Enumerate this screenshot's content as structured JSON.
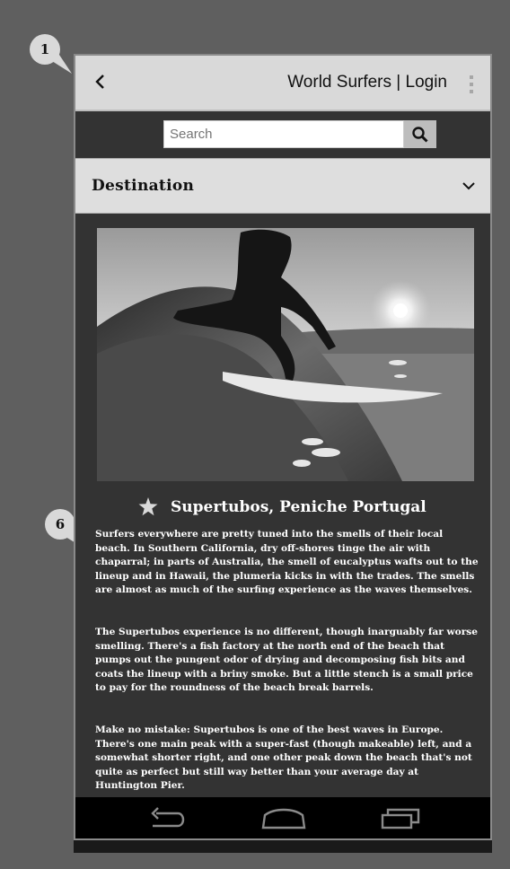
{
  "callouts": {
    "one": "1",
    "six": "6"
  },
  "appbar": {
    "title": "World Surfers | Login"
  },
  "search": {
    "placeholder": "Search"
  },
  "destination": {
    "label": "Destination"
  },
  "article": {
    "title": "Supertubos, Peniche Portugal",
    "paragraphs": [
      "Surfers everywhere are pretty tuned into the smells of their local beach. In Southern California, dry off-shores tinge the air with chaparral; in parts of Australia, the smell of eucalyptus wafts out to the lineup and in Hawaii, the plumeria kicks in with the trades. The smells are almost as much of the surfing experience as the waves themselves.",
      "The Supertubos experience is no different, though inarguably far worse smelling. There's a fish factory at the north end of the beach that pumps out the pungent odor of drying and decomposing fish bits and coats the lineup with a briny smoke. But a little stench is a small price to pay for the roundness of the beach break barrels.",
      "Make no mistake: Supertubos is one of the best waves in Europe. There's one main peak with a super-fast (though makeable) left, and a somewhat shorter right, and one other peak down the beach that's not quite as perfect but still way better than your average day at Huntington Pier."
    ]
  },
  "icons": {
    "back": "back-arrow-icon",
    "menu": "overflow-menu-icon",
    "search": "search-icon",
    "expand": "chevron-down-icon",
    "favorite": "star-icon",
    "nav_back": "nav-back-icon",
    "nav_home": "nav-home-icon",
    "nav_recent": "nav-recent-apps-icon"
  }
}
